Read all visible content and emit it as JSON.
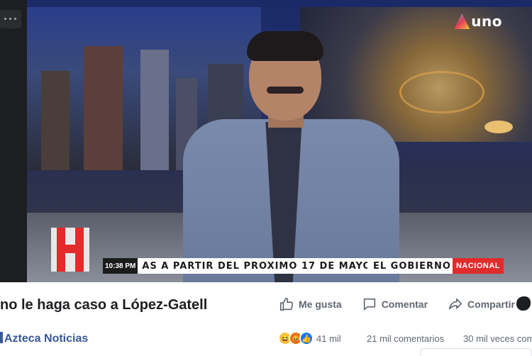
{
  "video": {
    "channel_logo": "uno",
    "ticker_time": "10:38 PM",
    "ticker_text": "AS A PARTIR DEL PRÓXIMO 17 DE MAYO....",
    "ticker_tag_left": "EL GOBIERNO",
    "ticker_tag": "NACIONAL"
  },
  "post": {
    "title": "no le haga caso a López-Gatell",
    "page_name": "Azteca Noticias"
  },
  "actions": {
    "like": "Me gusta",
    "comment": "Comentar",
    "share": "Compartir"
  },
  "stats": {
    "reactions_count": "41 mil",
    "comments": "21 mil comentarios",
    "shares": "30 mil veces com"
  },
  "icons": [
    "like-icon",
    "comment-icon",
    "share-icon",
    "haha-reaction-icon",
    "angry-reaction-icon",
    "like-reaction-icon"
  ],
  "colors": {
    "link": "#385898",
    "muted": "#606770",
    "ticker_red": "#e22b2b"
  }
}
